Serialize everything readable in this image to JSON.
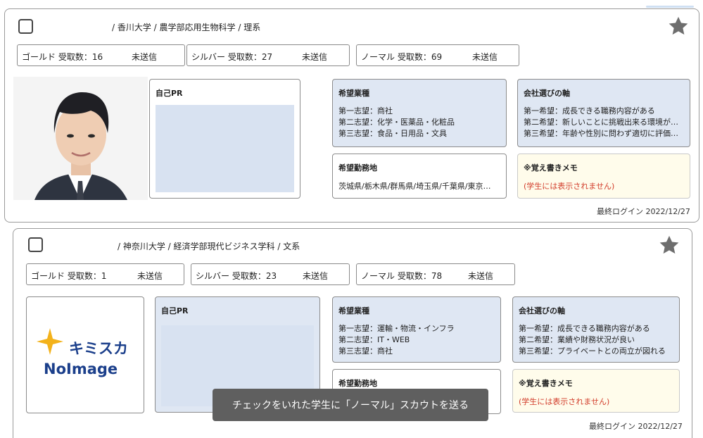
{
  "cards": [
    {
      "university": "/ 香川大学 / 農学部応用生物科学 / 理系",
      "scouts": [
        {
          "label": "ゴールド 受取数：16",
          "status": "未送信"
        },
        {
          "label": "シルバー 受取数：27",
          "status": "未送信"
        },
        {
          "label": "ノーマル 受取数：69",
          "status": "未送信"
        }
      ],
      "pr": {
        "title": "自己PR"
      },
      "industry": {
        "title": "希望業種",
        "lines": [
          "第一志望：商社",
          "第二志望：化学・医薬品・化粧品",
          "第三志望：食品・日用品・文具"
        ]
      },
      "axis": {
        "title": "会社選びの軸",
        "lines": [
          "第一希望：成長できる職務内容がある",
          "第二希望：新しいことに挑戦出来る環境が…",
          "第三希望：年齢や性別に問わず適切に評価…"
        ]
      },
      "location": {
        "title": "希望勤務地",
        "text": "茨城県/栃木県/群馬県/埼玉県/千葉県/東京…"
      },
      "memo": {
        "title": "※覚え書きメモ",
        "note": "(学生には表示されません)"
      },
      "last_login": "最終ログイン 2022/12/27"
    },
    {
      "university": "/ 神奈川大学 / 経済学部現代ビジネス学科 / 文系",
      "scouts": [
        {
          "label": "ゴールド 受取数：1",
          "status": "未送信"
        },
        {
          "label": "シルバー 受取数：23",
          "status": "未送信"
        },
        {
          "label": "ノーマル 受取数：78",
          "status": "未送信"
        }
      ],
      "logo": {
        "brand": "キミスカ",
        "text": "NoImage"
      },
      "pr": {
        "title": "自己PR"
      },
      "industry": {
        "title": "希望業種",
        "lines": [
          "第一志望：運輸・物流・インフラ",
          "第二志望：IT・WEB",
          "第三志望：商社"
        ]
      },
      "axis": {
        "title": "会社選びの軸",
        "lines": [
          "第一希望：成長できる職務内容がある",
          "第二希望：業績や財務状況が良い",
          "第三希望：プライベートとの両立が図れる"
        ]
      },
      "location": {
        "title": "希望勤務地"
      },
      "memo": {
        "title": "※覚え書きメモ",
        "note": "(学生には表示されません)"
      },
      "last_login": "最終ログイン 2022/12/27"
    }
  ],
  "toast": "チェックをいれた学生に「ノーマル」スカウトを送る",
  "colors": {
    "box_blue": "#dfe7f3",
    "memo_bg": "#fffceb",
    "memo_note": "#d23c2a",
    "star": "#6e6e6e",
    "brand_blue": "#1b3f8b",
    "brand_yellow": "#f3b21b"
  }
}
